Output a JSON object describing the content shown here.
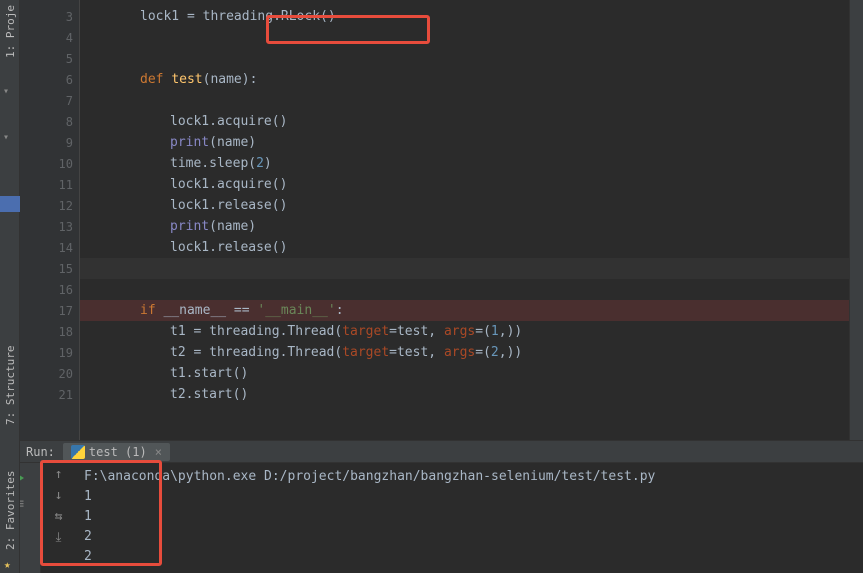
{
  "leftPanel": {
    "project_label": "1: Proje",
    "structure_label": "7: Structure"
  },
  "gutter": {
    "lines": [
      "3",
      "4",
      "5",
      "6",
      "7",
      "8",
      "9",
      "10",
      "11",
      "12",
      "13",
      "14",
      "15",
      "16",
      "17",
      "18",
      "19",
      "20",
      "21"
    ]
  },
  "code": {
    "line3a": "lock1 = ",
    "line3b": "threading.RLock()",
    "line6_kw": "def ",
    "line6_fn": "test",
    "line6_rest": "(name):",
    "line8": "lock1.acquire()",
    "line9_fn": "print",
    "line9_rest": "(name)",
    "line10a": "time.sleep(",
    "line10_num": "2",
    "line10b": ")",
    "line11": "lock1.acquire()",
    "line12": "lock1.release()",
    "line13_fn": "print",
    "line13_rest": "(name)",
    "line14": "lock1.release()",
    "line17_kw": "if ",
    "line17_a": "__name__ == ",
    "line17_str": "'__main__'",
    "line17_b": ":",
    "line18a": "t1 = threading.Thread(",
    "line18_p1": "target",
    "line18b": "=test, ",
    "line18_p2": "args",
    "line18c": "=(",
    "line18_num": "1",
    "line18d": ",))",
    "line19a": "t2 = threading.Thread(",
    "line19_p1": "target",
    "line19b": "=test, ",
    "line19_p2": "args",
    "line19c": "=(",
    "line19_num": "2",
    "line19d": ",))",
    "line20": "t1.start()",
    "line21": "t2.start()"
  },
  "runPanel": {
    "label": "Run:",
    "tab_name": "test (1)",
    "output": {
      "cmd": "F:\\anaconda\\python.exe D:/project/bangzhan/bangzhan-selenium/test/test.py",
      "l1": "1",
      "l2": "1",
      "l3": "2",
      "l4": "2"
    }
  },
  "favorites_label": "2: Favorites"
}
